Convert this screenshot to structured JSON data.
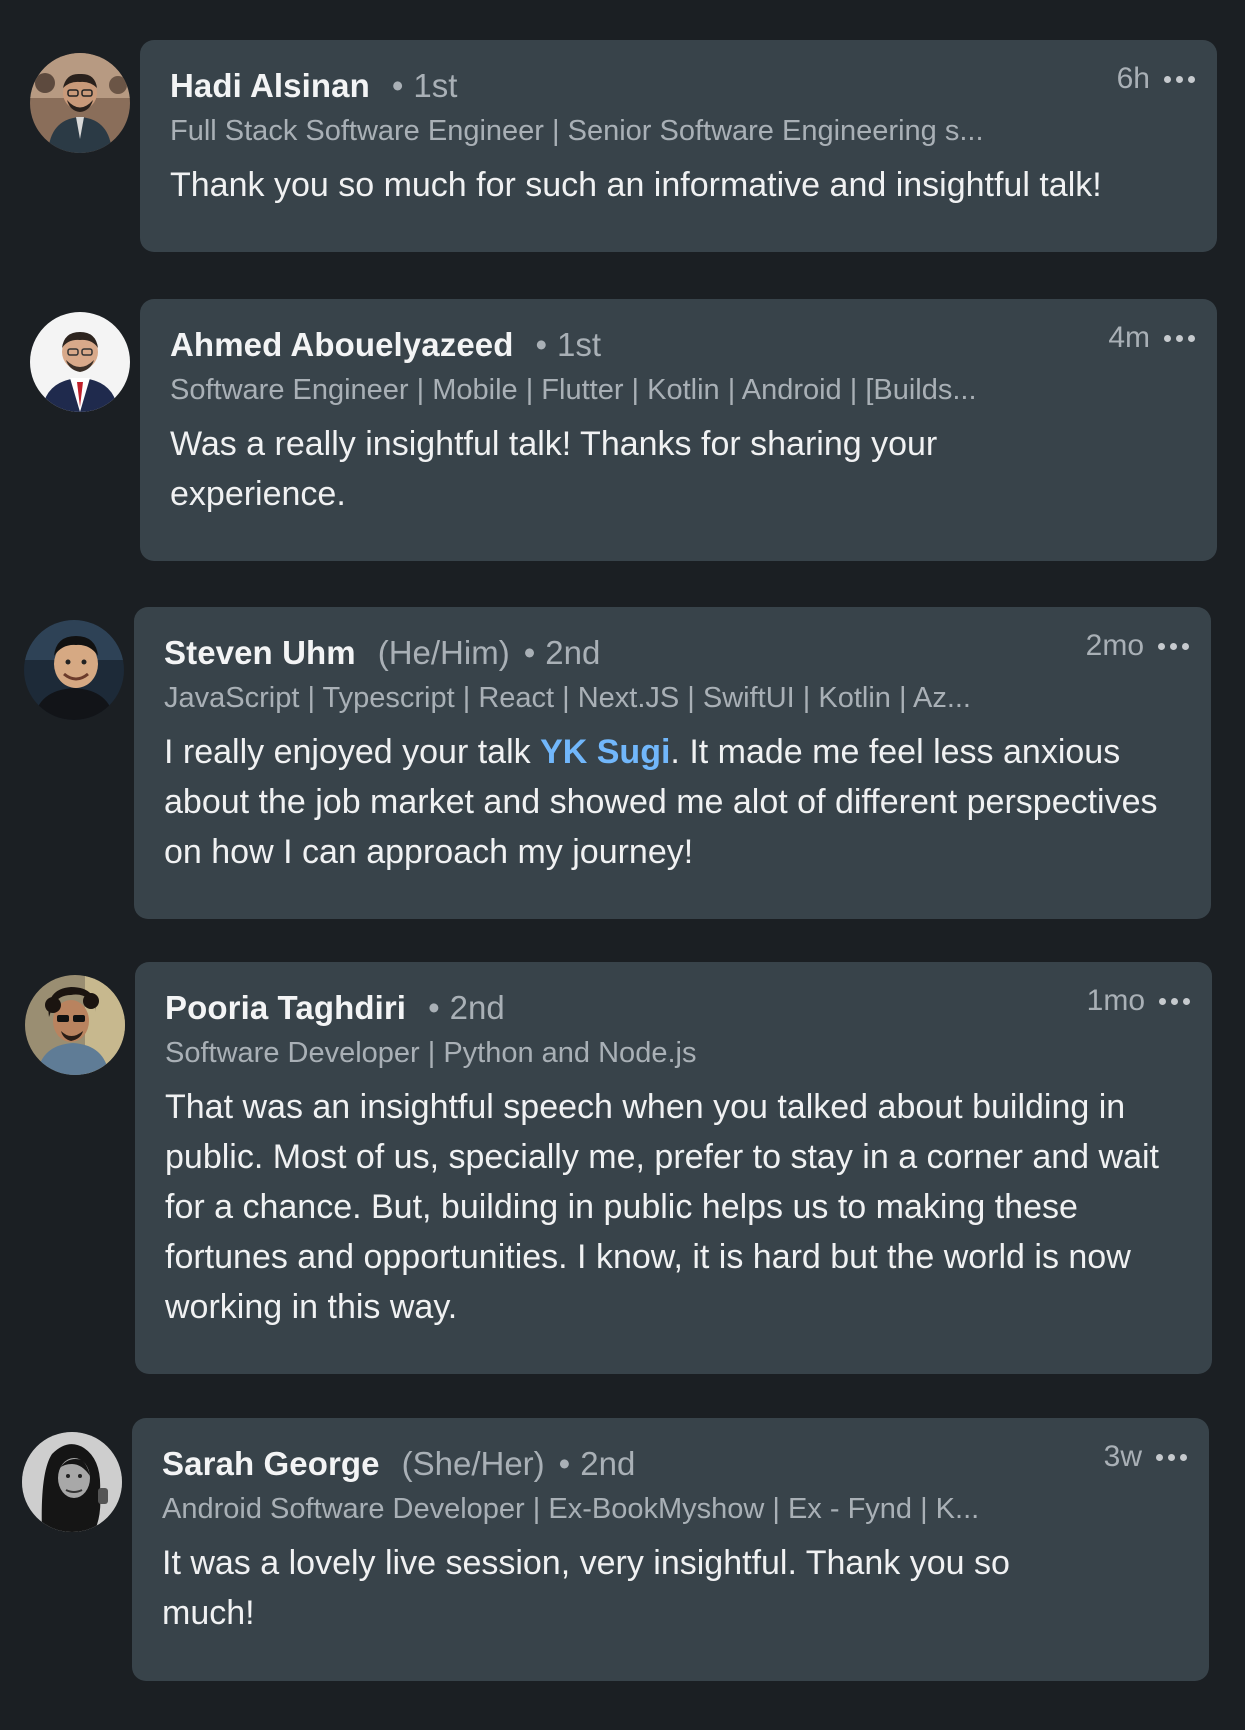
{
  "comments": [
    {
      "name": "Hadi Alsinan",
      "pronouns": "",
      "degree_dot": "•",
      "degree": "1st",
      "time": "6h",
      "headline": "Full Stack Software Engineer | Senior Software Engineering s...",
      "text_parts": {
        "before": "Thank you so much for such an informative and insightful talk!",
        "mention": "",
        "after": ""
      },
      "avatar_icon": "profile-photo-man-glasses-lanyard"
    },
    {
      "name": "Ahmed Abouelyazeed",
      "pronouns": "",
      "degree_dot": "•",
      "degree": "1st",
      "time": "4m",
      "headline": "Software Engineer | Mobile | Flutter | Kotlin | Android | [Builds...",
      "text_parts": {
        "before": "Was a really insightful talk! Thanks for sharing your experience.",
        "mention": "",
        "after": ""
      },
      "avatar_icon": "profile-photo-man-suit-red-tie"
    },
    {
      "name": "Steven Uhm",
      "pronouns": "(He/Him)",
      "degree_dot": "•",
      "degree": "2nd",
      "time": "2mo",
      "headline": "JavaScript | Typescript | React | Next.JS | SwiftUI | Kotlin | Az...",
      "text_parts": {
        "before": "I really enjoyed your talk ",
        "mention": "YK Sugi",
        "after": ". It made me feel less anxious about the job market and showed me alot of different perspectives on how I can approach my journey!"
      },
      "avatar_icon": "profile-photo-man-smiling-dark-background"
    },
    {
      "name": "Pooria Taghdiri",
      "pronouns": "",
      "degree_dot": "•",
      "degree": "2nd",
      "time": "1mo",
      "headline": "Software Developer | Python and Node.js",
      "text_parts": {
        "before": "That was an insightful speech when you talked about building in public. Most of us, specially me, prefer to stay in a corner and wait for a chance. But, building in public helps us to making these fortunes and opportunities. I know, it is hard but the world is now working in this way.",
        "mention": "",
        "after": ""
      },
      "avatar_icon": "profile-photo-man-curly-hair-sunglasses"
    },
    {
      "name": "Sarah George",
      "pronouns": "(She/Her)",
      "degree_dot": "•",
      "degree": "2nd",
      "time": "3w",
      "headline": "Android Software Developer | Ex-BookMyshow | Ex - Fynd | K...",
      "text_parts": {
        "before": "It was a lovely live session, very insightful. Thank you so much!",
        "mention": "",
        "after": ""
      },
      "avatar_icon": "profile-photo-woman-black-and-white"
    }
  ],
  "colors": {
    "background": "#1b1f23",
    "bubble": "#38434a",
    "mention": "#71b7fb",
    "secondary_text": "#a9b0b6"
  }
}
